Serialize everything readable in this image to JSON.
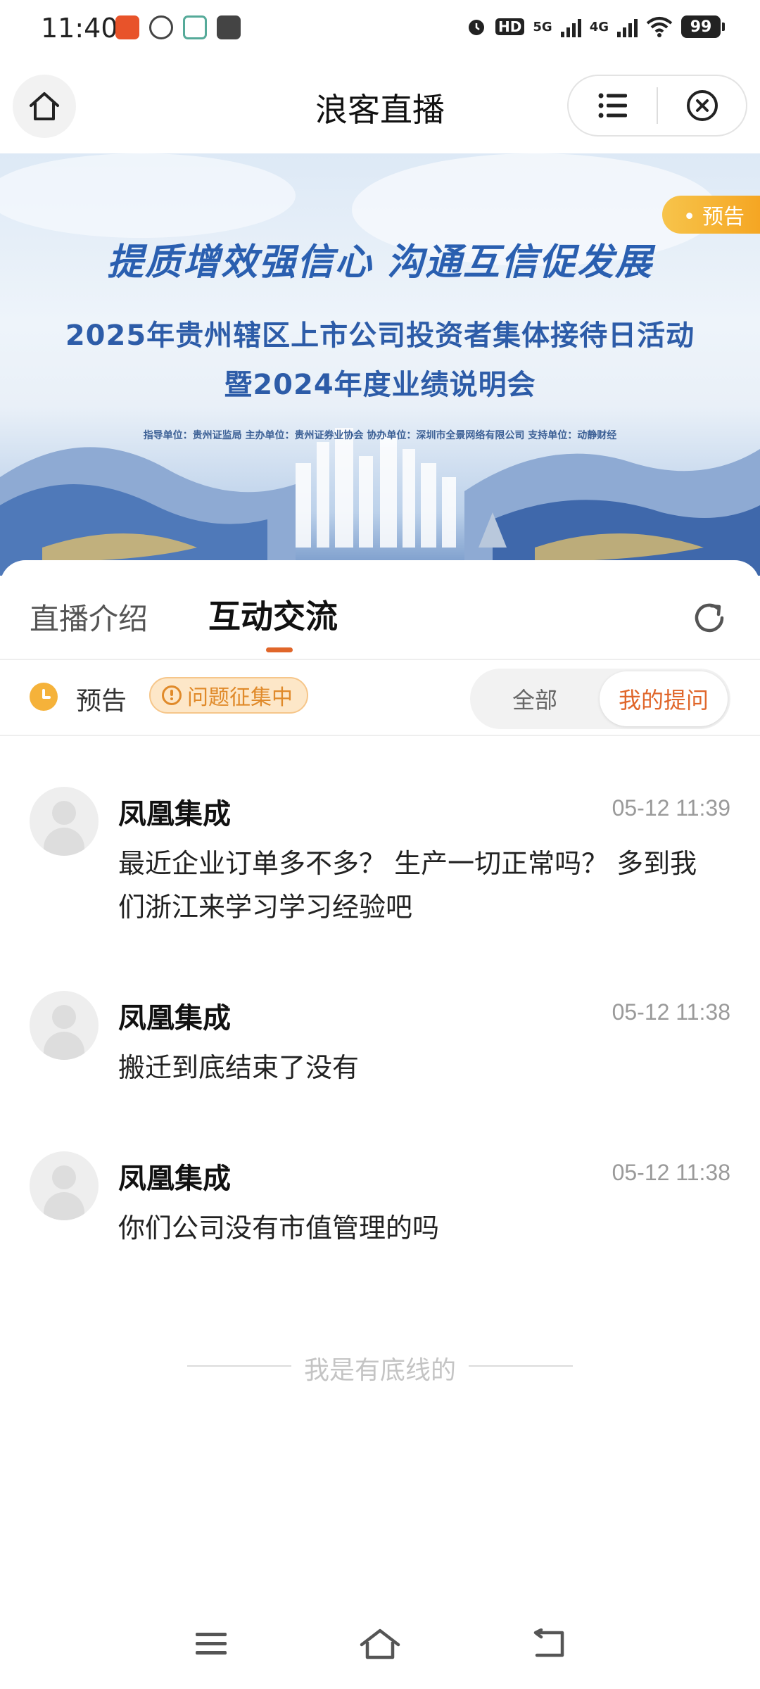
{
  "status_bar": {
    "time": "11:40",
    "signal_5g": "5G",
    "signal_4g": "4G",
    "hd_label": "HD",
    "battery": "99"
  },
  "header": {
    "title": "浪客直播"
  },
  "banner": {
    "tag": "• 预告",
    "slogan": "提质增效强信心   沟通互信促发展",
    "line1": "2025年贵州辖区上市公司投资者集体接待日活动",
    "line2": "暨2024年度业绩说明会",
    "credits": "指导单位：贵州证监局    主办单位：贵州证券业协会    协办单位：深圳市全景网络有限公司    支持单位：动静财经"
  },
  "tabs": {
    "intro": "直播介绍",
    "interact": "互动交流"
  },
  "filter": {
    "status": "预告",
    "badge": "问题征集中",
    "all": "全部",
    "mine": "我的提问"
  },
  "messages": [
    {
      "name": "凤凰集成",
      "time": "05-12 11:39",
      "text": "最近企业订单多不多？ 生产一切正常吗？ 多到我们浙江来学习学习经验吧"
    },
    {
      "name": "凤凰集成",
      "time": "05-12 11:38",
      "text": "搬迁到底结束了没有"
    },
    {
      "name": "凤凰集成",
      "time": "05-12 11:38",
      "text": "你们公司没有市值管理的吗"
    }
  ],
  "footer": {
    "bottom_text": "我是有底线的"
  },
  "colors": {
    "accent": "#e0662a",
    "badge_bg": "#fde7c8",
    "tag": "#f5a623",
    "banner_text": "#2d5ca8"
  }
}
